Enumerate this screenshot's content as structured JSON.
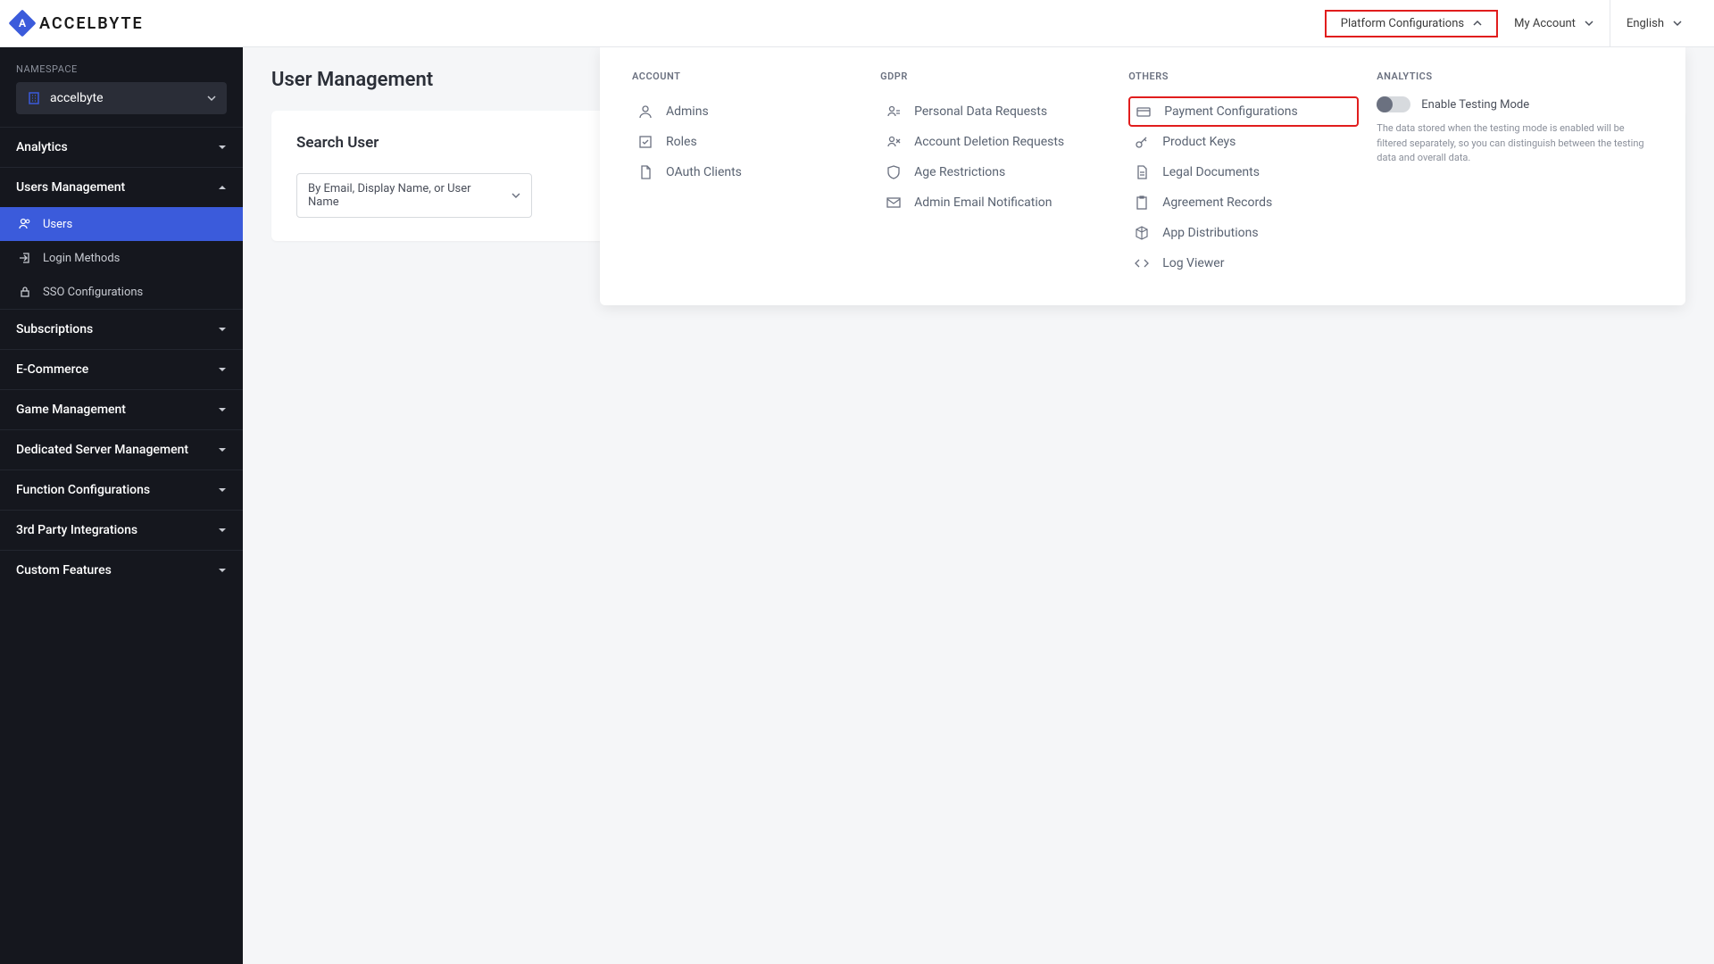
{
  "brand": {
    "mark": "A",
    "name": "ACCELBYTE"
  },
  "topbar": {
    "platform": "Platform Configurations",
    "account": "My Account",
    "language": "English"
  },
  "sidebar": {
    "namespace_label": "NAMESPACE",
    "namespace_value": "accelbyte",
    "sections": [
      {
        "label": "Analytics",
        "expanded": false
      },
      {
        "label": "Users Management",
        "expanded": true,
        "children": [
          {
            "label": "Users",
            "active": true
          },
          {
            "label": "Login Methods",
            "active": false
          },
          {
            "label": "SSO Configurations",
            "active": false
          }
        ]
      },
      {
        "label": "Subscriptions",
        "expanded": false
      },
      {
        "label": "E-Commerce",
        "expanded": false
      },
      {
        "label": "Game Management",
        "expanded": false
      },
      {
        "label": "Dedicated Server Management",
        "expanded": false
      },
      {
        "label": "Function Configurations",
        "expanded": false
      },
      {
        "label": "3rd Party Integrations",
        "expanded": false
      },
      {
        "label": "Custom Features",
        "expanded": false
      }
    ]
  },
  "page": {
    "title": "User Management",
    "card_title": "Search User",
    "search_select": "By Email, Display Name, or User Name"
  },
  "mega": {
    "account": {
      "head": "ACCOUNT",
      "items": [
        "Admins",
        "Roles",
        "OAuth Clients"
      ]
    },
    "gdpr": {
      "head": "GDPR",
      "items": [
        "Personal Data Requests",
        "Account Deletion Requests",
        "Age Restrictions",
        "Admin Email Notification"
      ]
    },
    "others": {
      "head": "OTHERS",
      "items": [
        "Payment Configurations",
        "Product Keys",
        "Legal Documents",
        "Agreement Records",
        "App Distributions",
        "Log Viewer"
      ]
    },
    "analytics": {
      "head": "ANALYTICS",
      "toggle_label": "Enable Testing Mode",
      "desc": "The data stored when the testing mode is enabled will be filtered separately, so you can distinguish between the testing data and overall data."
    }
  }
}
